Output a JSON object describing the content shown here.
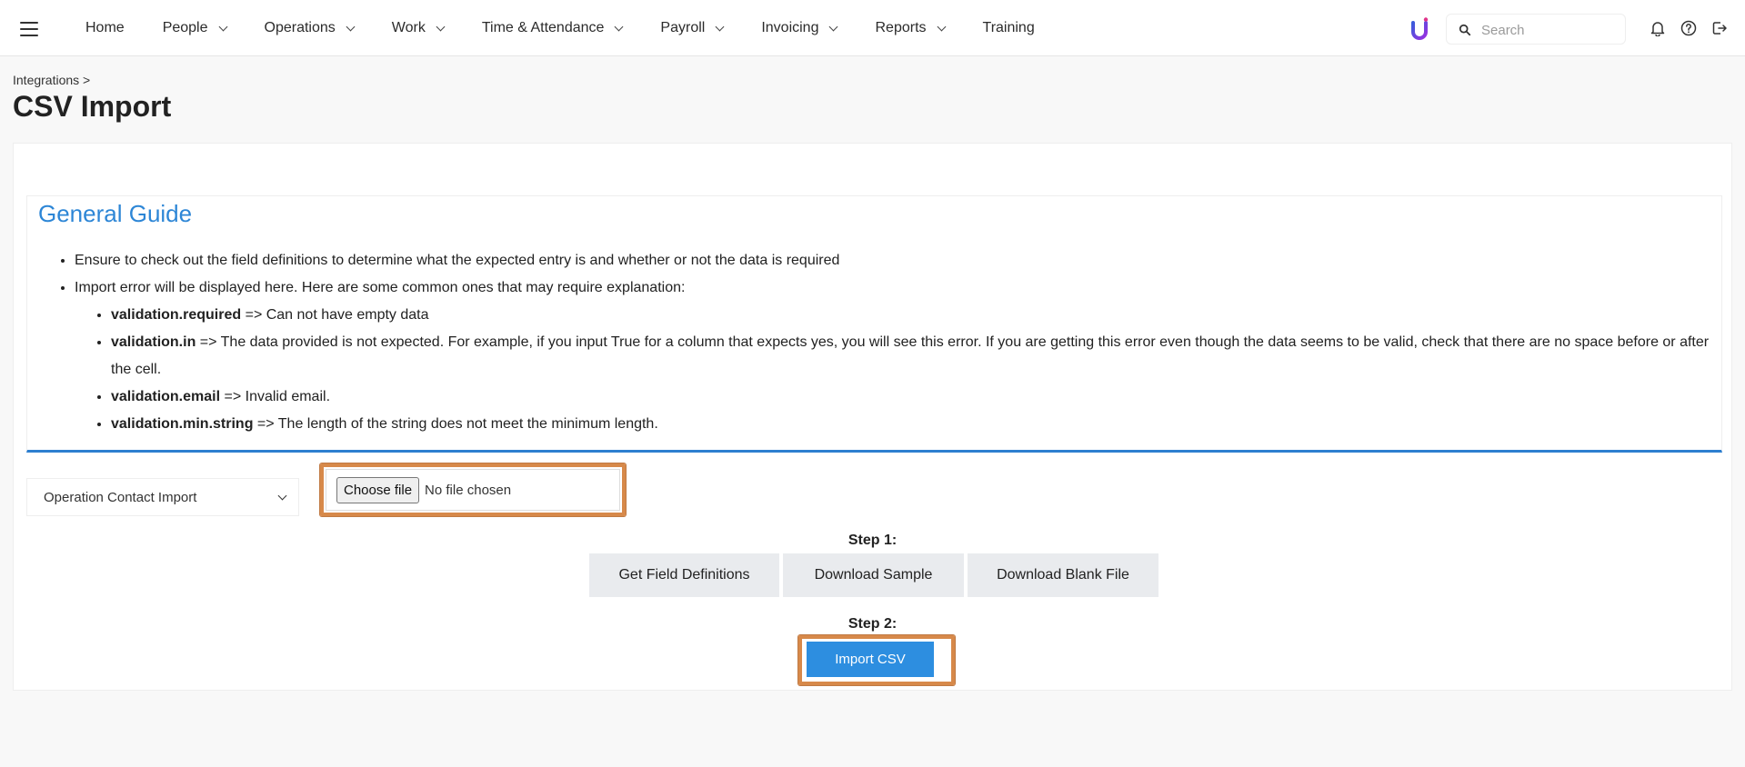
{
  "nav": {
    "items": [
      {
        "label": "Home",
        "dropdown": false
      },
      {
        "label": "People",
        "dropdown": true
      },
      {
        "label": "Operations",
        "dropdown": true
      },
      {
        "label": "Work",
        "dropdown": true
      },
      {
        "label": "Time & Attendance",
        "dropdown": true
      },
      {
        "label": "Payroll",
        "dropdown": true
      },
      {
        "label": "Invoicing",
        "dropdown": true
      },
      {
        "label": "Reports",
        "dropdown": true
      },
      {
        "label": "Training",
        "dropdown": false
      }
    ],
    "search_placeholder": "Search",
    "accent_color": "#2d8ee0",
    "logo_color": "#7b3fe4"
  },
  "header": {
    "breadcrumb": "Integrations >",
    "title": "CSV Import"
  },
  "guide": {
    "title": "General Guide",
    "item1": "Ensure to check out the field definitions to determine what the expected entry is and whether or not the data is required",
    "item2": "Import error will be displayed here. Here are some common ones that may require explanation:",
    "errors": [
      {
        "key": "validation.required",
        "desc": "=> Can not have empty data"
      },
      {
        "key": "validation.in",
        "desc": "=> The data provided is not expected. For example, if you input True for a column that expects yes, you will see this error. If you are getting this error even though the data seems to be valid, check that there are no space before or after the cell."
      },
      {
        "key": "validation.email",
        "desc": "=> Invalid email."
      },
      {
        "key": "validation.min.string",
        "desc": "=> The length of the string does not meet the minimum length."
      }
    ]
  },
  "import": {
    "selected_type": "Operation Contact Import",
    "file_button": "Choose file",
    "file_status": "No file chosen",
    "step1_label": "Step 1:",
    "step1_buttons": [
      "Get Field Definitions",
      "Download Sample",
      "Download Blank File"
    ],
    "step2_label": "Step 2:",
    "import_button": "Import CSV"
  }
}
